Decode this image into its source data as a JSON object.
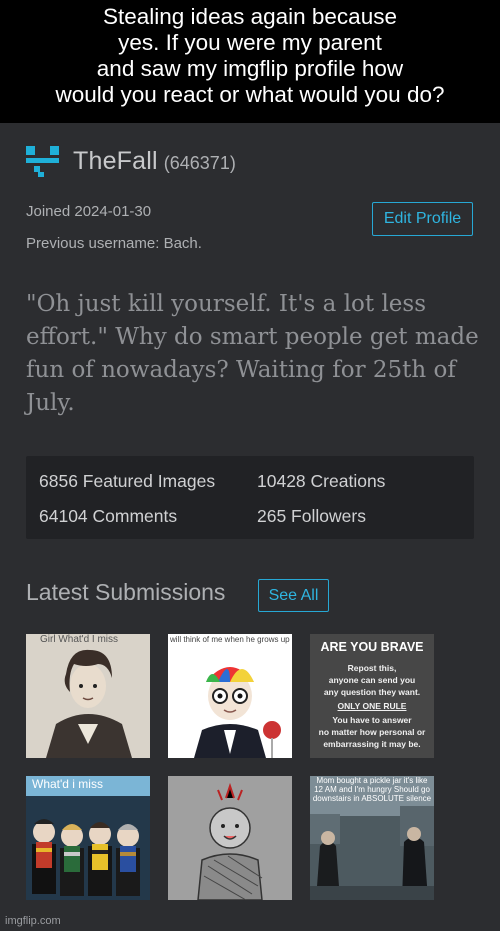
{
  "caption": {
    "lines": [
      "Stealing ideas again because",
      "yes. If you were my parent",
      "and saw my imgflip profile how",
      "would you react or what would you do?"
    ]
  },
  "profile": {
    "username": "TheFall",
    "user_id": "(646371)",
    "joined": "Joined 2024-01-30",
    "previous_username": "Previous username: Bach.",
    "edit_button": "Edit Profile",
    "bio": "\"Oh just kill yourself. It's a lot less effort.\" Why do smart people get made fun of nowadays? Waiting for 25th of July."
  },
  "stats": {
    "featured": "6856 Featured Images",
    "creations": "10428 Creations",
    "comments": "64104 Comments",
    "followers": "265 Followers"
  },
  "latest": {
    "title": "Latest Submissions",
    "see_all": "See All"
  },
  "thumbnails": [
    {
      "caption": "Girl What'd I miss"
    },
    {
      "caption": "will think of me when he grows up"
    },
    {
      "caption": "ARE YOU BRAVE",
      "lines": [
        "Repost this,",
        "anyone can send you",
        "any question they want.",
        "ONLY ONE RULE",
        "You have to answer",
        "no matter how personal or",
        "embarrassing it may be."
      ]
    },
    {
      "caption": "What'd i miss"
    },
    {
      "caption": ""
    },
    {
      "caption": "Mom bought a pickle jar it's like 12 AM and I'm hungry Should go downstairs in ABSOLUTE silence"
    }
  ],
  "watermark": "imgflip.com",
  "colors": {
    "accent": "#27a8d4",
    "background": "#2c2d30",
    "stats_panel": "#212225"
  }
}
